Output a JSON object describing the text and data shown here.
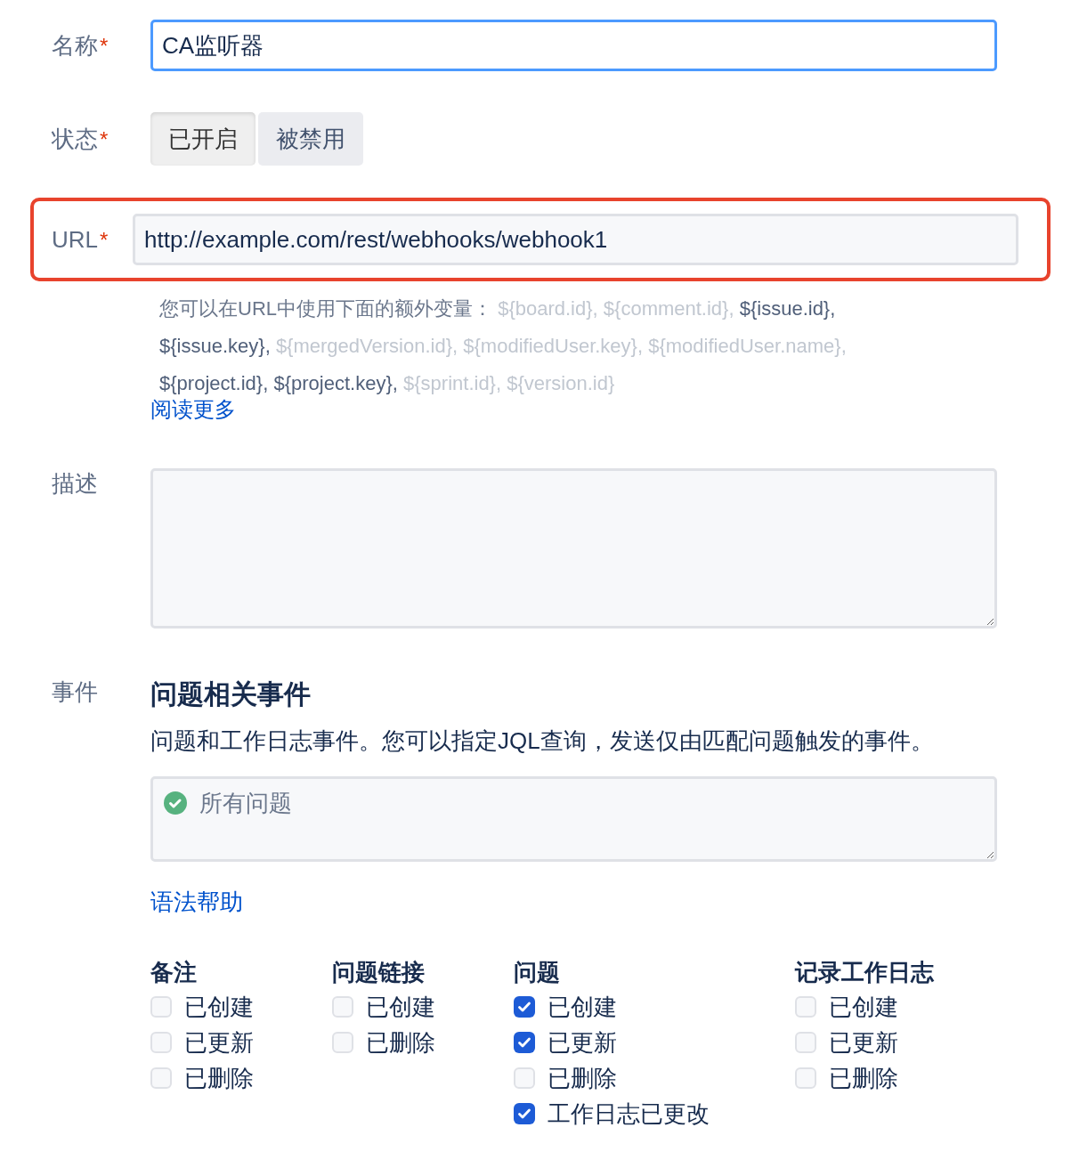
{
  "name_field": {
    "label": "名称",
    "required_mark": "*",
    "value": "CA监听器",
    "focused": true
  },
  "status_field": {
    "label": "状态",
    "required_mark": "*",
    "options": [
      {
        "label": "已开启",
        "selected": true
      },
      {
        "label": "被禁用",
        "selected": false
      }
    ]
  },
  "url_field": {
    "label": "URL",
    "required_mark": "*",
    "value": "http://example.com/rest/webhooks/webhook1",
    "highlighted": true,
    "help": {
      "intro": "您可以在URL中使用下面的额外变量：",
      "variables": [
        {
          "text": "${board.id},",
          "available": false
        },
        {
          "text": "${comment.id},",
          "available": false
        },
        {
          "text": "${issue.id},",
          "available": true
        },
        {
          "text": "${issue.key},",
          "available": true
        },
        {
          "text": "${mergedVersion.id},",
          "available": false
        },
        {
          "text": "${modifiedUser.key},",
          "available": false
        },
        {
          "text": "${modifiedUser.name},",
          "available": false
        },
        {
          "text": "${project.id},",
          "available": true
        },
        {
          "text": "${project.key},",
          "available": true
        },
        {
          "text": "${sprint.id},",
          "available": false
        },
        {
          "text": "${version.id}",
          "available": false
        }
      ],
      "link": "阅读更多"
    }
  },
  "description_field": {
    "label": "描述"
  },
  "events": {
    "label": "事件",
    "title": "问题相关事件",
    "text": "问题和工作日志事件。您可以指定JQL查询，发送仅由匹配问题触发的事件。",
    "jql": {
      "placeholder": "所有问题",
      "valid": true
    },
    "syntax_link": "语法帮助",
    "groups": [
      {
        "title": "备注",
        "items": [
          {
            "label": "已创建",
            "checked": false
          },
          {
            "label": "已更新",
            "checked": false
          },
          {
            "label": "已删除",
            "checked": false
          }
        ]
      },
      {
        "title": "问题链接",
        "items": [
          {
            "label": "已创建",
            "checked": false
          },
          {
            "label": "已删除",
            "checked": false
          }
        ]
      },
      {
        "title": "问题",
        "items": [
          {
            "label": "已创建",
            "checked": true
          },
          {
            "label": "已更新",
            "checked": true
          },
          {
            "label": "已删除",
            "checked": false
          },
          {
            "label": "工作日志已更改",
            "checked": true
          }
        ]
      },
      {
        "title": "记录工作日志",
        "items": [
          {
            "label": "已创建",
            "checked": false
          },
          {
            "label": "已更新",
            "checked": false
          },
          {
            "label": "已删除",
            "checked": false
          }
        ]
      }
    ]
  }
}
